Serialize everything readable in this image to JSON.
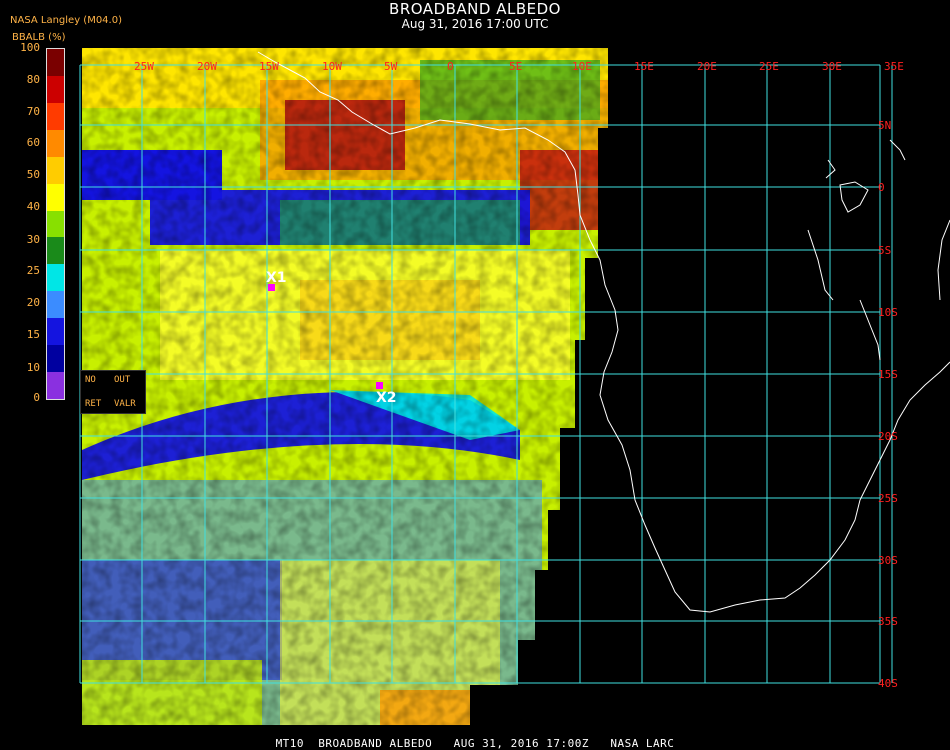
{
  "header": {
    "title": "BROADBAND ALBEDO",
    "datetime": "Aug 31, 2016 17:00 UTC",
    "org": "NASA Langley (M04.0)",
    "unit": "BBALB (%)"
  },
  "colorbar": {
    "labels": [
      "100",
      "80",
      "70",
      "60",
      "50",
      "40",
      "30",
      "25",
      "20",
      "15",
      "10",
      "0"
    ],
    "colors": [
      "#7a0000",
      "#cc0000",
      "#ff3b00",
      "#ff8a00",
      "#ffcc00",
      "#ffff00",
      "#88e000",
      "#1a8a1a",
      "#00e6e6",
      "#3b8cff",
      "#1414e0",
      "#0000a0",
      "#8a30e0"
    ]
  },
  "legend_box": {
    "no": "NO",
    "out": "OUT",
    "ret": "RET",
    "valr": "VALR"
  },
  "grid": {
    "lon_labels": [
      "25W",
      "20W",
      "15W",
      "10W",
      "5W",
      "0",
      "5E",
      "10E",
      "15E",
      "20E",
      "25E",
      "30E",
      "35E"
    ],
    "lat_labels": [
      "5N",
      "0",
      "5S",
      "10S",
      "15S",
      "20S",
      "25S",
      "30S",
      "35S",
      "40S"
    ],
    "line_color": "#40e0e0",
    "label_color": "#ff2020"
  },
  "markers": [
    {
      "label": "X1"
    },
    {
      "label": "X2"
    }
  ],
  "footer": "MT10  BROADBAND ALBEDO   AUG 31, 2016 17:00Z   NASA LARC"
}
